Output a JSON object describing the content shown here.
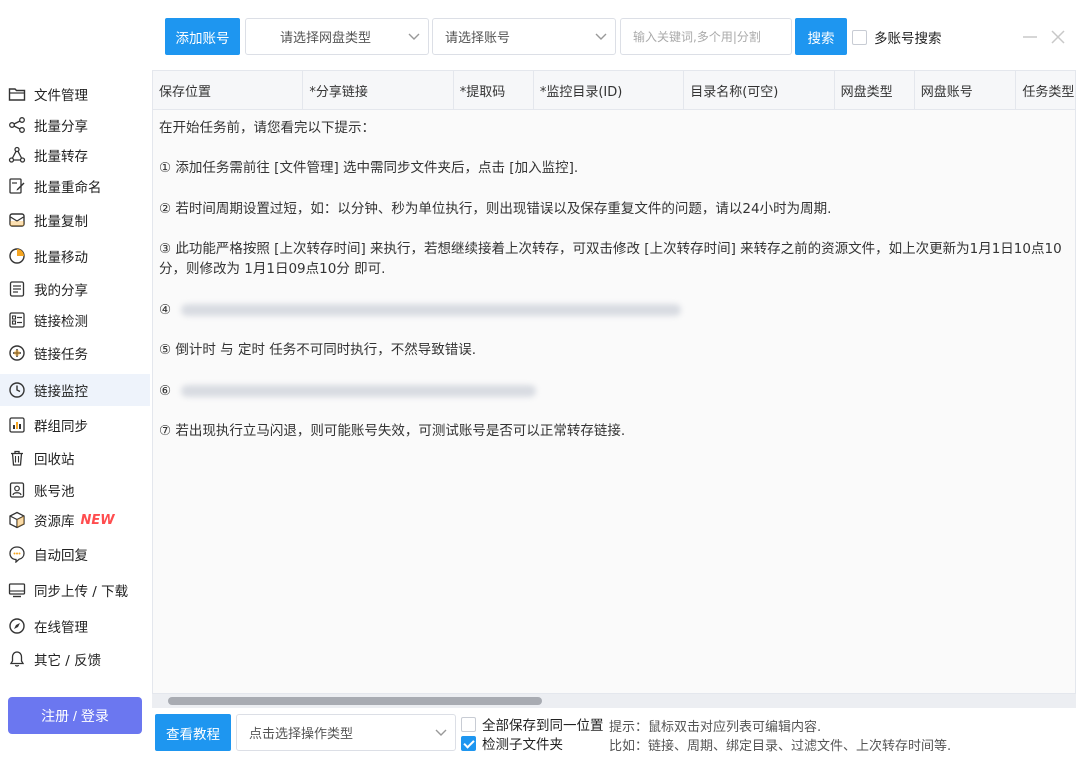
{
  "toolbar": {
    "add_account": "添加账号",
    "netdisk_type_placeholder": "请选择网盘类型",
    "account_placeholder": "请选择账号",
    "keyword_placeholder": "输入关键词,多个用|分割",
    "search": "搜索",
    "multi_account_search": "多账号搜索"
  },
  "sidebar": {
    "items": [
      {
        "label": "文件管理",
        "icon": "folder-icon"
      },
      {
        "label": "批量分享",
        "icon": "share-icon"
      },
      {
        "label": "批量转存",
        "icon": "transfer-icon"
      },
      {
        "label": "批量重命名",
        "icon": "rename-icon"
      },
      {
        "label": "批量复制",
        "icon": "copy-icon"
      },
      {
        "label": "批量移动",
        "icon": "move-icon"
      },
      {
        "label": "我的分享",
        "icon": "my-share-icon"
      },
      {
        "label": "链接检测",
        "icon": "link-check-icon"
      },
      {
        "label": "链接任务",
        "icon": "link-task-icon"
      },
      {
        "label": "链接监控",
        "icon": "link-monitor-icon"
      },
      {
        "label": "群组同步",
        "icon": "group-sync-icon"
      },
      {
        "label": "回收站",
        "icon": "trash-icon"
      },
      {
        "label": "账号池",
        "icon": "account-pool-icon"
      },
      {
        "label": "资源库",
        "icon": "resource-library-icon",
        "badge": "NEW"
      },
      {
        "label": "自动回复",
        "icon": "auto-reply-icon"
      },
      {
        "label": "同步上传 / 下载",
        "icon": "upload-download-icon"
      },
      {
        "label": "在线管理",
        "icon": "online-manage-icon"
      },
      {
        "label": "其它 / 反馈",
        "icon": "bell-icon"
      }
    ],
    "active_index": 9,
    "login_button": "注册 / 登录"
  },
  "table": {
    "columns": [
      "保存位置",
      "*分享链接",
      "*提取码",
      "*监控目录(ID)",
      "目录名称(可空)",
      "网盘类型",
      "网盘账号",
      "任务类型"
    ],
    "intro": "在开始任务前，请您看完以下提示：",
    "tips": [
      "① 添加任务需前往 [文件管理] 选中需同步文件夹后，点击 [加入监控].",
      "② 若时间周期设置过短，如：以分钟、秒为单位执行，则出现错误以及保存重复文件的问题，请以24小时为周期.",
      "③ 此功能严格按照 [上次转存时间] 来执行，若想继续接着上次转存，可双击修改 [上次转存时间] 来转存之前的资源文件，如上次更新为1月1日10点10分，则修改为 1月1日09点10分 即可.",
      "④",
      "⑤ 倒计时 与 定时 任务不可同时执行，不然导致错误.",
      "⑥",
      "⑦ 若出现执行立马闪退，则可能账号失效，可测试账号是否可以正常转存链接."
    ]
  },
  "bottom": {
    "tutorial": "查看教程",
    "operation_placeholder": "点击选择操作类型",
    "save_same_location": "全部保存到同一位置",
    "detect_subfolder": "检测子文件夹",
    "save_same_location_checked": false,
    "detect_subfolder_checked": true,
    "hint_line1": "提示：鼠标双击对应列表可编辑内容.",
    "hint_line2": "比如：链接、周期、绑定目录、过滤文件、上次转存时间等."
  },
  "colors": {
    "primary": "#1e96f0",
    "login": "#6b77f0",
    "new_badge": "#ff4d4f",
    "active_bg": "#eef3fb"
  }
}
